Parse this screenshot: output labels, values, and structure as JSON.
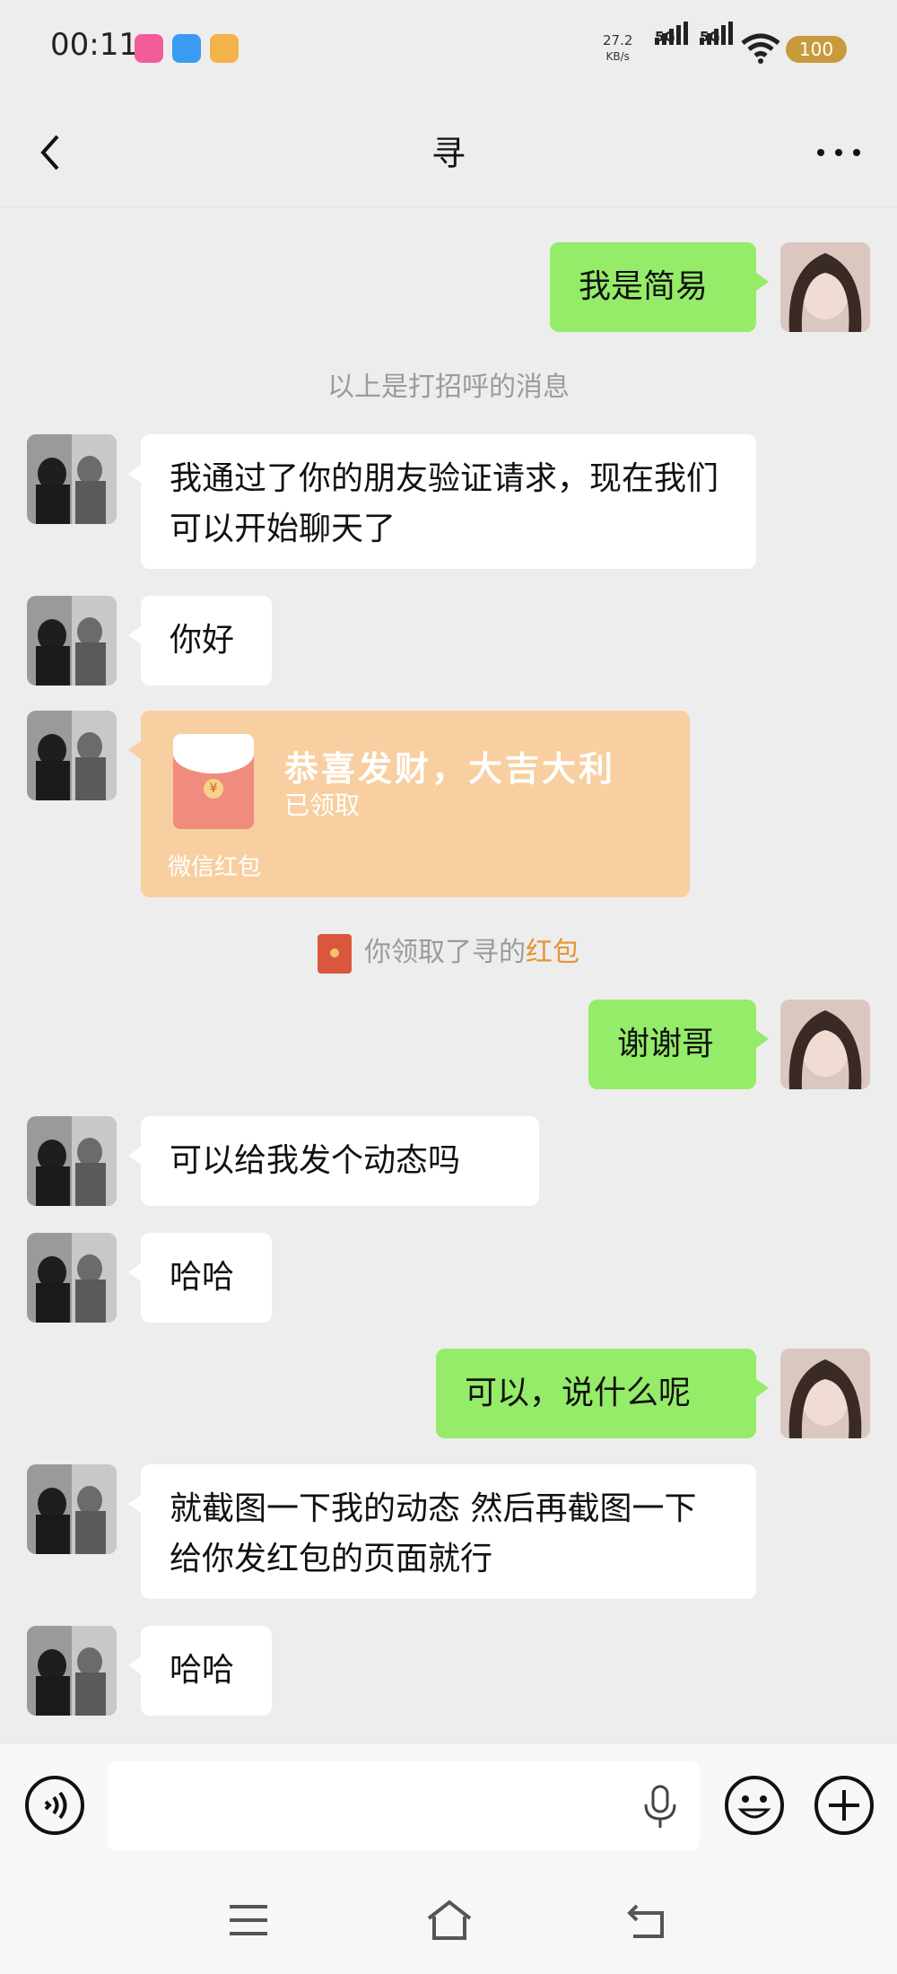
{
  "status_bar": {
    "time": "00:11",
    "net_speed_value": "27.2",
    "net_speed_unit": "KB/s",
    "sim1": "5G",
    "sim2": "5G",
    "battery": "100"
  },
  "nav": {
    "title": "寻"
  },
  "messages": {
    "m1": "我是简易",
    "sys1": "以上是打招呼的消息",
    "m2": "我通过了你的朋友验证请求，现在我们可以开始聊天了",
    "m3": "你好",
    "m4": "谢谢哥",
    "m5": "可以给我发个动态吗",
    "m6": "哈哈",
    "m7": "可以，说什么呢",
    "m8": "就截图一下我的动态 然后再截图一下给你发红包的页面就行",
    "m9": "哈哈"
  },
  "red_packet": {
    "title": "恭喜发财，大吉大利",
    "status": "已领取",
    "footer": "微信红包"
  },
  "sys_received": {
    "prefix": "你领取了寻的",
    "highlight": "红包"
  },
  "colors": {
    "outgoing_bubble": "#95ec69",
    "incoming_bubble": "#ffffff",
    "red_packet": "#f8cfa0",
    "highlight": "#e79432"
  }
}
